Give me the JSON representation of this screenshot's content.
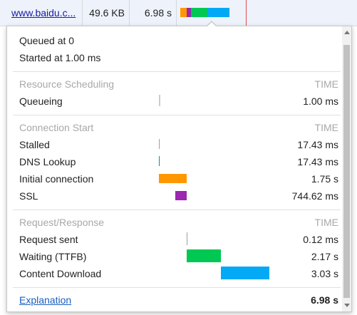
{
  "row": {
    "name": "www.baidu.c...",
    "size": "49.6 KB",
    "time": "6.98 s"
  },
  "popup": {
    "queued_at": "Queued at 0",
    "started_at": "Started at 1.00 ms",
    "sections": [
      {
        "title": "Resource Scheduling",
        "time_header": "TIME",
        "rows": [
          {
            "label": "Queueing",
            "value": "1.00 ms"
          }
        ]
      },
      {
        "title": "Connection Start",
        "time_header": "TIME",
        "rows": [
          {
            "label": "Stalled",
            "value": "17.43 ms"
          },
          {
            "label": "DNS Lookup",
            "value": "17.43 ms"
          },
          {
            "label": "Initial connection",
            "value": "1.75 s"
          },
          {
            "label": "SSL",
            "value": "744.62 ms"
          }
        ]
      },
      {
        "title": "Request/Response",
        "time_header": "TIME",
        "rows": [
          {
            "label": "Request sent",
            "value": "0.12 ms"
          },
          {
            "label": "Waiting (TTFB)",
            "value": "2.17 s"
          },
          {
            "label": "Content Download",
            "value": "3.03 s"
          }
        ]
      }
    ],
    "explanation_label": "Explanation",
    "total": "6.98 s"
  },
  "colors": {
    "queueing": "#cccccc",
    "stalled": "#9e9e9e",
    "dns": "#009688",
    "initial_connection": "#ff9800",
    "ssl": "#9c27b0",
    "request_sent": "#9e9e9e",
    "ttfb": "#00c853",
    "content_download": "#03a9f4",
    "link": "#1a5fbf"
  }
}
